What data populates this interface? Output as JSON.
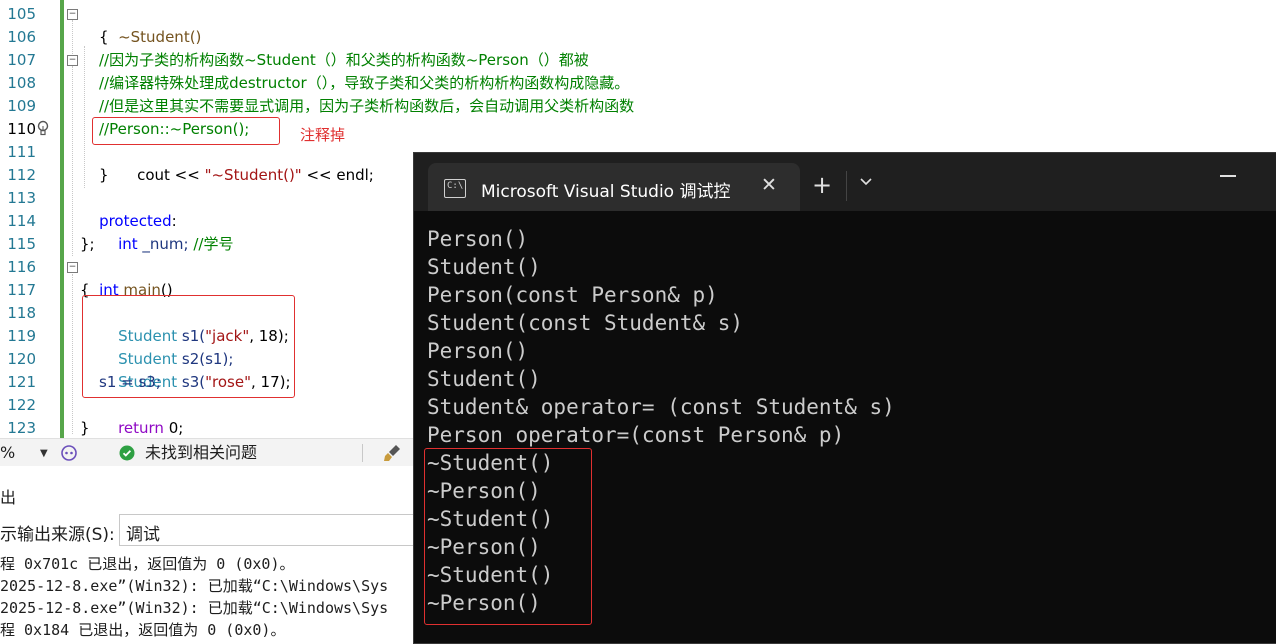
{
  "editor": {
    "line_numbers": [
      "105",
      "106",
      "107",
      "108",
      "109",
      "110",
      "111",
      "112",
      "113",
      "114",
      "115",
      "116",
      "117",
      "118",
      "119",
      "120",
      "121",
      "122",
      "123"
    ],
    "code": {
      "l105": "~Student()",
      "l106": "{",
      "l107": "//因为子类的析构函数~Student（）和父类的析构函数~Person（）都被",
      "l108": "//编译器特殊处理成destructor（），导致子类和父类的析构析构函数构成隐藏。",
      "l109": "//但是这里其实不需要显式调用，因为子类析构函数后，会自动调用父类析构函数",
      "l110": "//Person::~Person();",
      "l111_a": "cout << ",
      "l111_b": "\"~Student()\"",
      "l111_c": " << endl;",
      "l112": "}",
      "l113_kw": "protected",
      "l113_p": ":",
      "l114_kw": "int",
      "l114_var": " _num; ",
      "l114_cmt": "//学号",
      "l115": "};",
      "l116_kw": "int",
      "l116_fn": " main",
      "l116_p": "()",
      "l117": "{",
      "l118_t": "Student",
      "l118_v": " s1(",
      "l118_s": "\"jack\"",
      "l118_e": ", 18);",
      "l119_t": "Student",
      "l119_v": " s2(s1);",
      "l120_t": "Student",
      "l120_v": " s3(",
      "l120_s": "\"rose\"",
      "l120_e": ", 17);",
      "l121": "s1 = s3;",
      "l122_kw": "return",
      "l122_e": " 0;",
      "l123": "}"
    },
    "annotation": "注释掉"
  },
  "statusbar": {
    "zoom": "%",
    "issues": "未找到相关问题"
  },
  "output": {
    "title_fragment": "出",
    "source_label": "示输出来源(S):",
    "source_value": "调试",
    "lines": [
      "程 0x701c 已退出，返回值为 0 (0x0)。",
      "2025-12-8.exe”(Win32): 已加载“C:\\Windows\\Sys",
      "2025-12-8.exe”(Win32): 已加载“C:\\Windows\\Sys",
      "程 0x184 已退出，返回值为 0 (0x0)。"
    ]
  },
  "console": {
    "tab_title": "Microsoft Visual Studio 调试控",
    "close_glyph": "✕",
    "new_tab_glyph": "+",
    "dropdown_glyph": "⌄",
    "minimize_glyph": "—",
    "lines": [
      "Person()",
      "Student()",
      "Person(const Person& p)",
      "Student(const Student& s)",
      "Person()",
      "Student()",
      "Student& operator= (const Student& s)",
      "Person operator=(const Person& p)",
      "~Student()",
      "~Person()",
      "~Student()",
      "~Person()",
      "~Student()",
      "~Person()"
    ]
  }
}
